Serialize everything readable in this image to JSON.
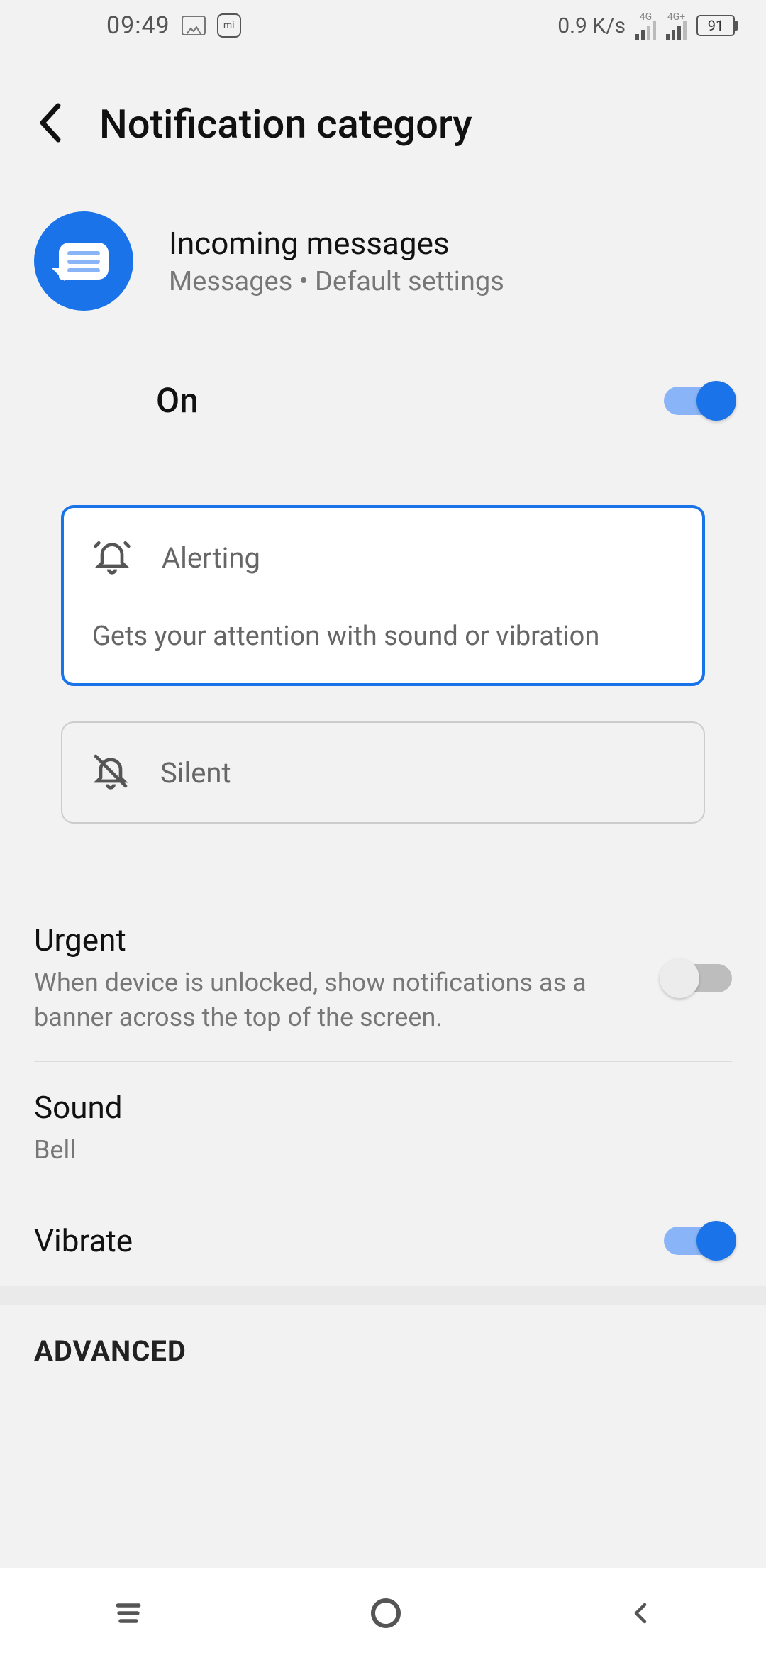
{
  "status": {
    "time": "09:49",
    "net_speed": "0.9 K/s",
    "sig1_label": "4G",
    "sig2_label": "4G+",
    "battery": "91"
  },
  "header": {
    "title": "Notification category"
  },
  "app": {
    "title": "Incoming messages",
    "subtitle": "Messages  • Default settings"
  },
  "master": {
    "label": "On",
    "enabled": true
  },
  "behavior": {
    "alerting": {
      "title": "Alerting",
      "desc": "Gets your attention with sound or vibration",
      "selected": true
    },
    "silent": {
      "title": "Silent",
      "selected": false
    }
  },
  "settings": {
    "urgent": {
      "title": "Urgent",
      "desc": "When device is unlocked, show notifications as a banner across the top of the screen.",
      "enabled": false
    },
    "sound": {
      "title": "Sound",
      "value": "Bell"
    },
    "vibrate": {
      "title": "Vibrate",
      "enabled": true
    }
  },
  "section": {
    "advanced": "ADVANCED"
  }
}
